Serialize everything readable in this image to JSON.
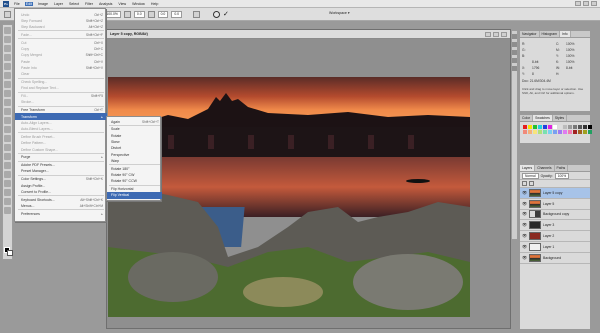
{
  "menubar": {
    "logo": "Ps",
    "items": [
      "File",
      "Edit",
      "Image",
      "Layer",
      "Select",
      "Filter",
      "Analysis",
      "View",
      "Window",
      "Help"
    ]
  },
  "options": {
    "zoom_box": "100%",
    "zoom_box2": "100%",
    "w_label": "W:",
    "w_value": "100.0%",
    "h_label": "H:",
    "h_value": "100.0%",
    "angle_value": "0.0",
    "h_skew": "0.0",
    "v_skew": "0.0",
    "workspace": "Workspace ▾"
  },
  "document": {
    "title": "Layer 5 copy, RGB/8#)"
  },
  "edit_menu": [
    {
      "label": "Undo",
      "shortcut": "Ctrl+Z",
      "state": "dim"
    },
    {
      "label": "Step Forward",
      "shortcut": "Shift+Ctrl+Z",
      "state": "dim"
    },
    {
      "label": "Step Backward",
      "shortcut": "Alt+Ctrl+Z",
      "state": "dim"
    },
    {
      "label": "Fade...",
      "shortcut": "Shift+Ctrl+F",
      "state": "dim"
    },
    {
      "label": "Cut",
      "shortcut": "Ctrl+X",
      "state": "dim"
    },
    {
      "label": "Copy",
      "shortcut": "Ctrl+C",
      "state": "dim"
    },
    {
      "label": "Copy Merged",
      "shortcut": "Shift+Ctrl+C",
      "state": "dim"
    },
    {
      "label": "Paste",
      "shortcut": "Ctrl+V",
      "state": "dim"
    },
    {
      "label": "Paste Into",
      "shortcut": "Shift+Ctrl+V",
      "state": "dim"
    },
    {
      "label": "Clear",
      "shortcut": "",
      "state": "dim"
    },
    {
      "label": "Check Spelling...",
      "shortcut": "",
      "state": "dim"
    },
    {
      "label": "Find and Replace Text...",
      "shortcut": "",
      "state": "dim"
    },
    {
      "label": "Fill...",
      "shortcut": "Shift+F5",
      "state": "dim"
    },
    {
      "label": "Stroke...",
      "shortcut": "",
      "state": "dim"
    },
    {
      "label": "Free Transform",
      "shortcut": "Ctrl+T",
      "state": "normal"
    },
    {
      "label": "Transform",
      "shortcut": "▸",
      "state": "hl"
    },
    {
      "label": "Auto-Align Layers...",
      "shortcut": "",
      "state": "dim"
    },
    {
      "label": "Auto-Blend Layers...",
      "shortcut": "",
      "state": "dim"
    },
    {
      "label": "Define Brush Preset...",
      "shortcut": "",
      "state": "dim"
    },
    {
      "label": "Define Pattern...",
      "shortcut": "",
      "state": "dim"
    },
    {
      "label": "Define Custom Shape...",
      "shortcut": "",
      "state": "dim"
    },
    {
      "label": "Purge",
      "shortcut": "▸",
      "state": "normal"
    },
    {
      "label": "Adobe PDF Presets...",
      "shortcut": "",
      "state": "normal"
    },
    {
      "label": "Preset Manager...",
      "shortcut": "",
      "state": "normal"
    },
    {
      "label": "Color Settings...",
      "shortcut": "Shift+Ctrl+K",
      "state": "normal"
    },
    {
      "label": "Assign Profile...",
      "shortcut": "",
      "state": "normal"
    },
    {
      "label": "Convert to Profile...",
      "shortcut": "",
      "state": "normal"
    },
    {
      "label": "Keyboard Shortcuts...",
      "shortcut": "Alt+Shift+Ctrl+K",
      "state": "normal"
    },
    {
      "label": "Menus...",
      "shortcut": "Alt+Shift+Ctrl+M",
      "state": "normal"
    },
    {
      "label": "Preferences",
      "shortcut": "▸",
      "state": "normal"
    }
  ],
  "transform_menu": [
    {
      "label": "Again",
      "shortcut": "Shift+Ctrl+T",
      "state": "normal"
    },
    {
      "label": "Scale",
      "shortcut": "",
      "state": "normal"
    },
    {
      "label": "Rotate",
      "shortcut": "",
      "state": "normal"
    },
    {
      "label": "Skew",
      "shortcut": "",
      "state": "normal"
    },
    {
      "label": "Distort",
      "shortcut": "",
      "state": "normal"
    },
    {
      "label": "Perspective",
      "shortcut": "",
      "state": "normal"
    },
    {
      "label": "Warp",
      "shortcut": "",
      "state": "normal"
    },
    {
      "label": "Rotate 180°",
      "shortcut": "",
      "state": "normal"
    },
    {
      "label": "Rotate 90° CW",
      "shortcut": "",
      "state": "normal"
    },
    {
      "label": "Rotate 90° CCW",
      "shortcut": "",
      "state": "normal"
    },
    {
      "label": "Flip Horizontal",
      "shortcut": "",
      "state": "normal"
    },
    {
      "label": "Flip Vertical",
      "shortcut": "",
      "state": "hl"
    }
  ],
  "navigator": {
    "tabs": [
      "Navigator",
      "Histogram",
      "Info"
    ],
    "r_label": "R:",
    "g_label": "G:",
    "b_label": "B:",
    "c_label": "C:",
    "m_label": "M:",
    "y_label": "Y:",
    "k_label": "K:",
    "c_value": "100%",
    "m_value": "100%",
    "y_value": "100%",
    "k_value": "100%",
    "bits": "8-bit",
    "bits2": "8-bit",
    "x_label": "X:",
    "x_value": "1796",
    "y2_label": "Y:",
    "y2_value": "8",
    "w_label": "W:",
    "h_label": "H:",
    "doc": "Doc: 21.6M/304.4M",
    "note": "Click and drag to move layer or selection. Use Shift, Alt, and Ctrl for additional options."
  },
  "color_panel": {
    "tabs": [
      "Color",
      "Swatches",
      "Styles"
    ]
  },
  "layers": {
    "tabs": [
      "Layers",
      "Channels",
      "Paths"
    ],
    "blend_mode": "Normal",
    "opacity_label": "Opacity:",
    "opacity_value": "100%",
    "items": [
      {
        "name": "Layer 5 copy",
        "thumb": "land",
        "hl": true
      },
      {
        "name": "Layer 5",
        "thumb": "land",
        "hl": false
      },
      {
        "name": "Background copy",
        "thumb": "mixed",
        "hl": false
      },
      {
        "name": "Layer 3",
        "thumb": "dark",
        "hl": false
      },
      {
        "name": "Layer 2",
        "thumb": "red",
        "hl": false
      },
      {
        "name": "Layer 1",
        "thumb": "blank",
        "hl": false
      },
      {
        "name": "Background",
        "thumb": "land",
        "hl": false
      }
    ]
  },
  "colors": {
    "menu_highlight": "#3d6ab3",
    "layer_highlight": "#a7c3e8",
    "sky_top": "#5a2c27",
    "sky_glow": "#f08a4a"
  }
}
